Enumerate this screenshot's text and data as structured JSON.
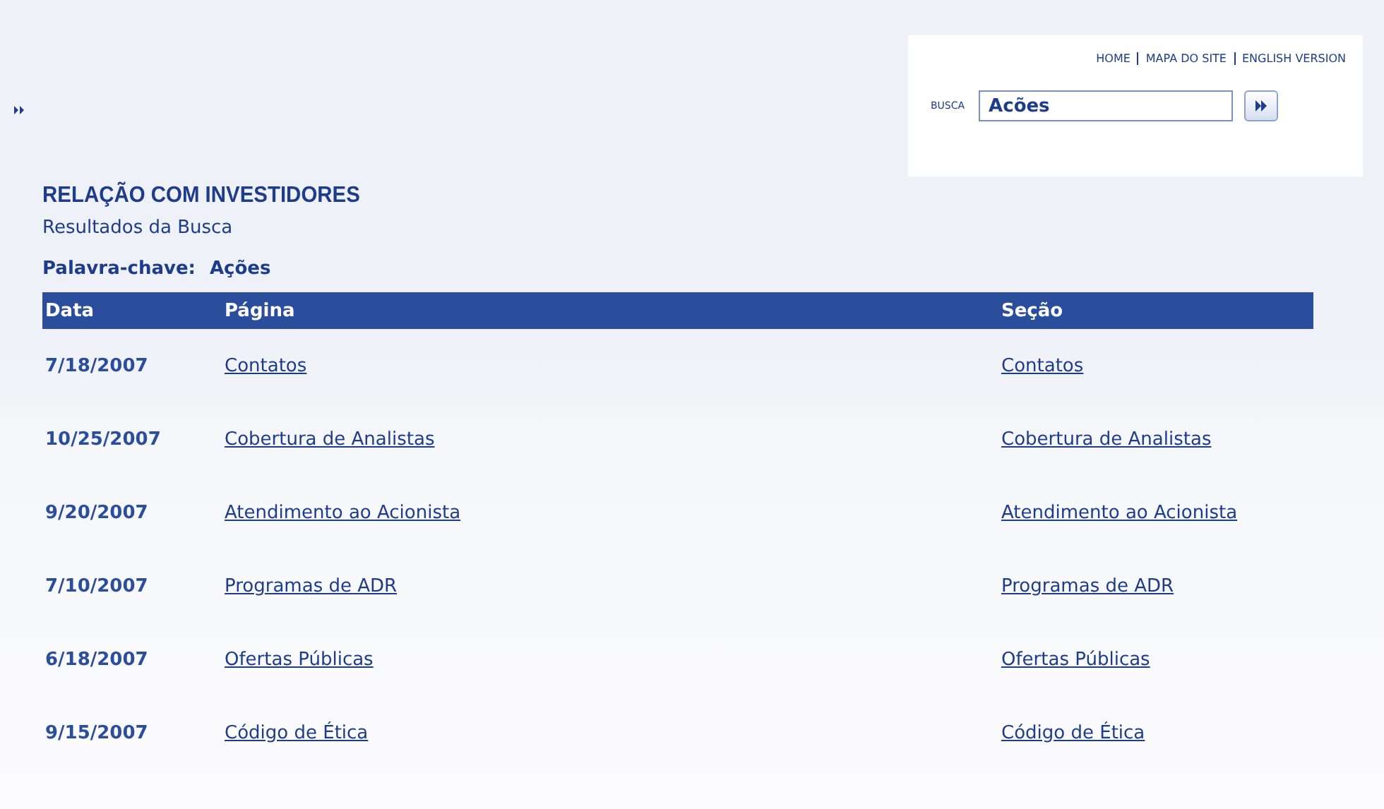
{
  "top_links": [
    "HOME",
    "MAPA DO SITE",
    "ENGLISH VERSION"
  ],
  "search": {
    "label": "BUSCA",
    "value": "Acões"
  },
  "title": "RELAÇÃO COM INVESTIDORES",
  "subtitle": "Resultados da Busca",
  "keyword": {
    "label": "Palavra-chave:",
    "value": "Ações"
  },
  "table": {
    "columns": [
      "Data",
      "Página",
      "Seção"
    ],
    "rows": [
      {
        "date": "7/18/2007",
        "page": "Contatos",
        "section": "Contatos"
      },
      {
        "date": "10/25/2007",
        "page": "Cobertura de Analistas",
        "section": "Cobertura de Analistas"
      },
      {
        "date": "9/20/2007",
        "page": "Atendimento ao Acionista",
        "section": "Atendimento ao Acionista"
      },
      {
        "date": "7/10/2007",
        "page": "Programas de ADR",
        "section": "Programas de ADR"
      },
      {
        "date": "6/18/2007",
        "page": "Ofertas Públicas",
        "section": "Ofertas Públicas"
      },
      {
        "date": "9/15/2007",
        "page": "Código de Ética",
        "section": "Código de Ética"
      }
    ]
  }
}
